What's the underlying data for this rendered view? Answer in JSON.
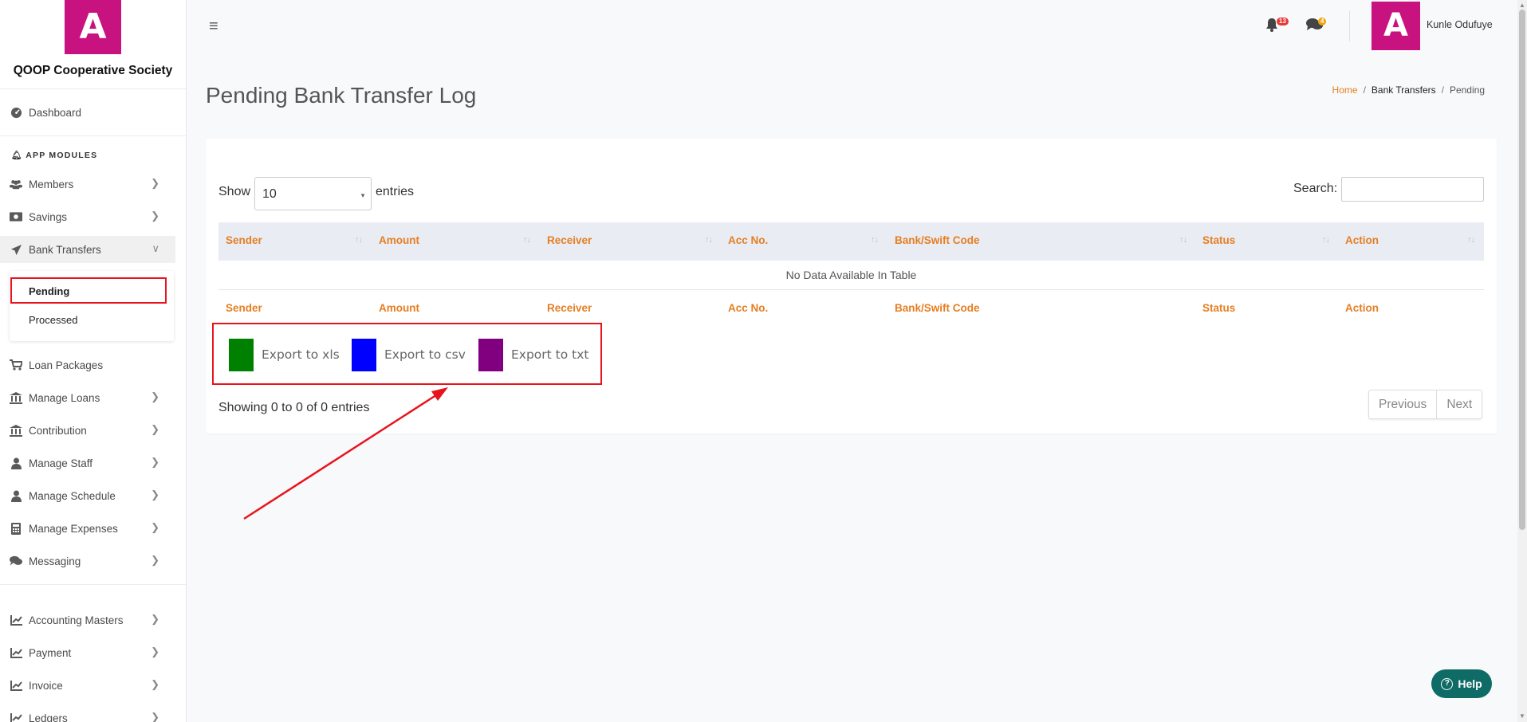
{
  "brand": {
    "logo_letter": "A",
    "name": "QOOP Cooperative Society",
    "color": "#c8127f"
  },
  "sidebar": {
    "dashboard": "Dashboard",
    "section_label": "APP MODULES",
    "items": [
      {
        "label": "Members",
        "icon": "users-icon"
      },
      {
        "label": "Savings",
        "icon": "money-icon"
      },
      {
        "label": "Bank Transfers",
        "icon": "paper-plane-icon"
      },
      {
        "label": "Loan Packages",
        "icon": "cart-icon"
      },
      {
        "label": "Manage Loans",
        "icon": "bank-icon"
      },
      {
        "label": "Contribution",
        "icon": "bank-icon"
      },
      {
        "label": "Manage Staff",
        "icon": "user-icon"
      },
      {
        "label": "Manage Schedule",
        "icon": "user-icon"
      },
      {
        "label": "Manage Expenses",
        "icon": "calculator-icon"
      },
      {
        "label": "Messaging",
        "icon": "comments-icon"
      },
      {
        "label": "Accounting Masters",
        "icon": "chart-icon"
      },
      {
        "label": "Payment",
        "icon": "chart-icon"
      },
      {
        "label": "Invoice",
        "icon": "chart-icon"
      },
      {
        "label": "Ledgers",
        "icon": "chart-icon"
      }
    ],
    "submenu": {
      "pending": "Pending",
      "processed": "Processed"
    }
  },
  "topbar": {
    "notifications_count": "13",
    "messages_count": "4",
    "avatar_letter": "A",
    "user_name": "Kunle Odufuye"
  },
  "page": {
    "title": "Pending Bank Transfer Log",
    "breadcrumb": {
      "home": "Home",
      "section": "Bank Transfers",
      "current": "Pending"
    }
  },
  "table": {
    "show_label": "Show",
    "page_size": "10",
    "entries_label": "entries",
    "search_label": "Search:",
    "columns": [
      "Sender",
      "Amount",
      "Receiver",
      "Acc No.",
      "Bank/Swift Code",
      "Status",
      "Action"
    ],
    "empty_message": "No Data Available In Table",
    "info": "Showing 0 to 0 of 0 entries",
    "prev_label": "Previous",
    "next_label": "Next"
  },
  "exports": [
    {
      "label": "Export to xls",
      "color": "#008000"
    },
    {
      "label": "Export to csv",
      "color": "#0000ff"
    },
    {
      "label": "Export to txt",
      "color": "#800080"
    }
  ],
  "help_label": "Help",
  "colors": {
    "accent_orange": "#e67e22",
    "annotation_red": "#e8141c",
    "help_teal": "#0f6b65"
  }
}
